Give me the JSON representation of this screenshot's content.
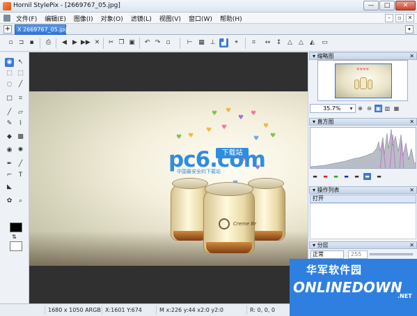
{
  "window": {
    "title": "Hornil StylePix - [2669767_05.jpg]",
    "controls": {
      "minimize": "—",
      "maximize": "□",
      "close": "✕"
    }
  },
  "menu": {
    "items": [
      "文件(F)",
      "编辑(E)",
      "图像(I)",
      "对象(O)",
      "滤镜(L)",
      "视图(V)",
      "窗口(W)",
      "帮助(H)"
    ]
  },
  "tabs": {
    "add_label": "+",
    "document_tab": "X 2669767_05.jpg",
    "menu_label": "▾"
  },
  "toolbar": {
    "icons": [
      "new-icon",
      "open-icon",
      "save-icon",
      "print-icon",
      "first-icon",
      "prev-icon",
      "next-icon",
      "last-icon",
      "close-icon",
      "cut-icon",
      "copy-icon",
      "paste-icon",
      "undo-icon",
      "redo-icon",
      "delete-icon",
      "align-left-icon",
      "grid-icon",
      "rotate-icon",
      "canvas-icon",
      "crop-icon",
      "flip-h-icon",
      "flip-v-icon",
      "rotate-ccw-icon",
      "rotate-cw-icon",
      "fit-icon",
      "image-size-icon",
      "canvas-size-icon"
    ]
  },
  "tools": {
    "icons": [
      "eye-icon",
      "move-arrow-icon",
      "lasso-rect-icon",
      "rect-select-icon",
      "lasso-icon",
      "magic-wand-icon",
      "crop-rect-icon",
      "crop-icon",
      "brush-icon",
      "eraser-icon",
      "pencil-icon",
      "clone-icon",
      "fill-icon",
      "gradient-icon",
      "redeye-icon",
      "blur-icon",
      "pen-icon",
      "line-icon",
      "shape-icon",
      "text-icon",
      "dropper-icon",
      "color-icon",
      "zoom-icon"
    ],
    "foreground_color": "#000000",
    "background_color": "#ffffff"
  },
  "canvas": {
    "brand_text": "pc6.com",
    "brand_badge": "下载站",
    "brand_tagline": "中国最安全的下载站",
    "jar_label": "Creme Br"
  },
  "panels": {
    "navigator": {
      "title": "缩略图",
      "zoom": "35.7%"
    },
    "histogram": {
      "title": "直方图"
    },
    "history": {
      "title": "操作列表",
      "items": [
        "打开"
      ]
    },
    "layers": {
      "title": "分层",
      "blend_mode": "正常",
      "opacity": "255"
    },
    "close_label": "✕"
  },
  "status": {
    "size": "1680 x 1050 ARGB",
    "cursor": "X:1601 Y:674",
    "selection": "M x:226 y:44 x2:0 y2:0",
    "color": "R: 0, 0, 0"
  },
  "watermark": {
    "title": "华军软件园",
    "site": "ONLINEDOWN",
    "suffix": ".NET"
  }
}
